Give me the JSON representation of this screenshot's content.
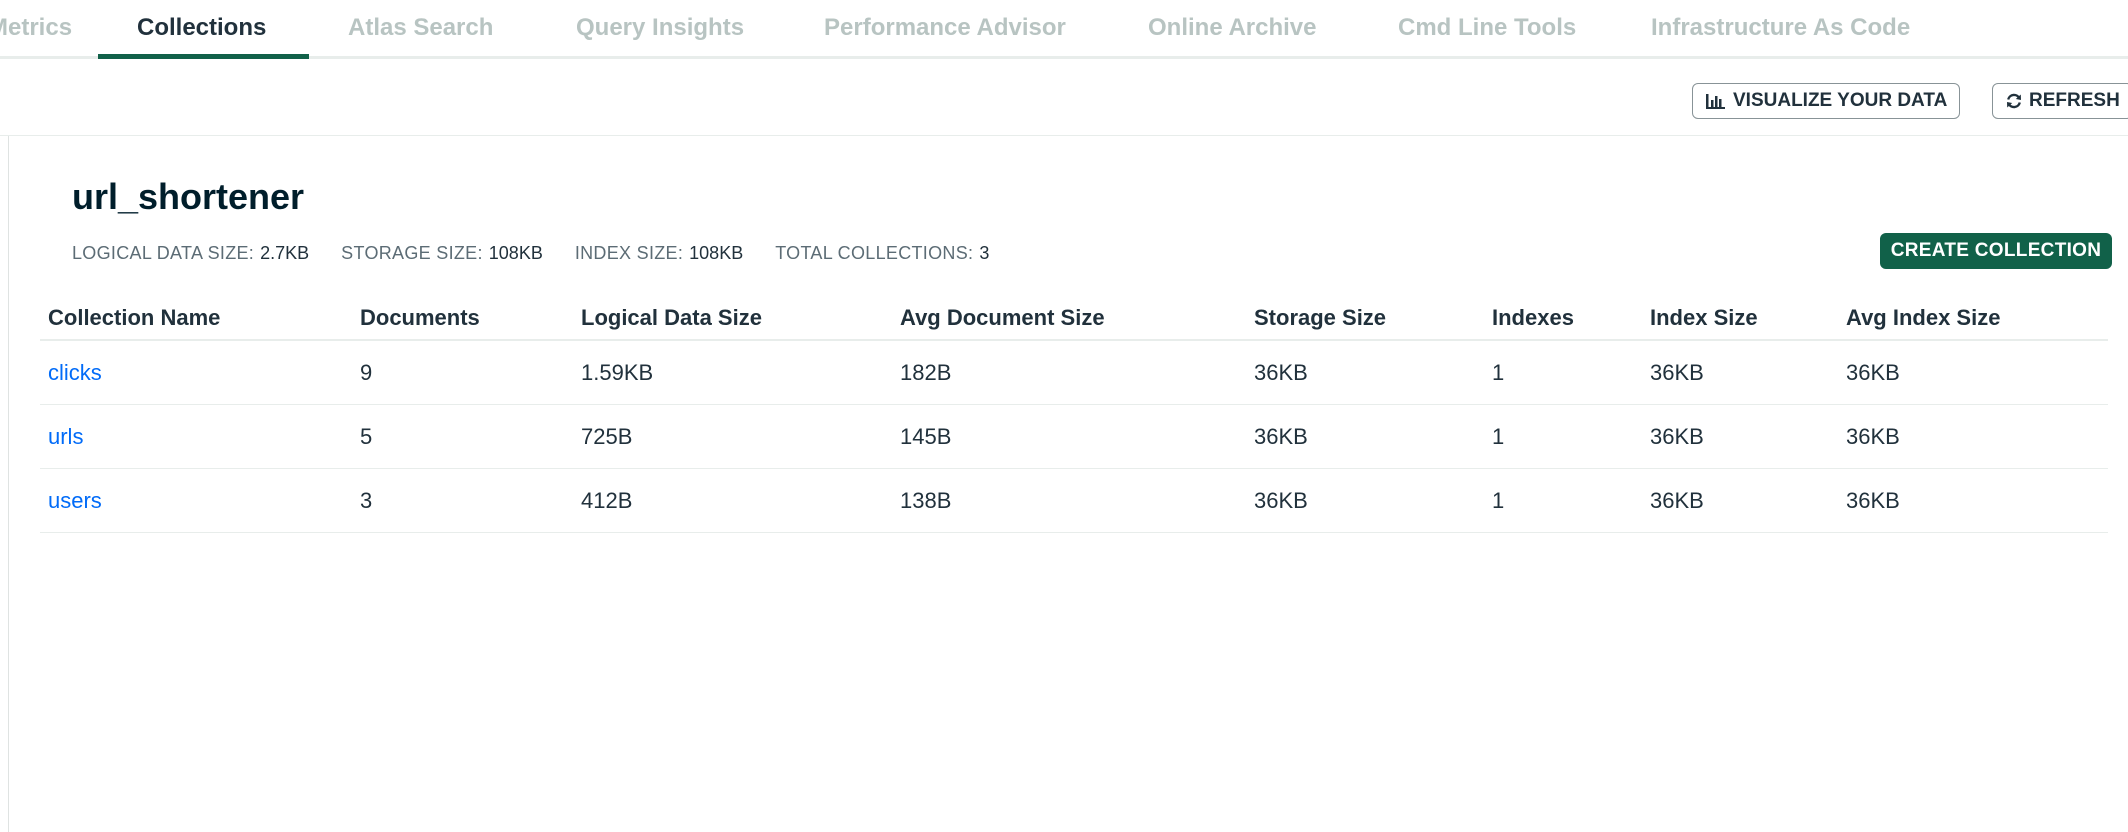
{
  "tabs": [
    {
      "label": "Metrics"
    },
    {
      "label": "Collections"
    },
    {
      "label": "Atlas Search"
    },
    {
      "label": "Query Insights"
    },
    {
      "label": "Performance Advisor"
    },
    {
      "label": "Online Archive"
    },
    {
      "label": "Cmd Line Tools"
    },
    {
      "label": "Infrastructure As Code"
    }
  ],
  "toolbar": {
    "visualize_label": "VISUALIZE YOUR DATA",
    "refresh_label": "REFRESH"
  },
  "database": {
    "name": "url_shortener",
    "stats": [
      {
        "label": "LOGICAL DATA SIZE:",
        "value": "2.7KB"
      },
      {
        "label": "STORAGE SIZE:",
        "value": "108KB"
      },
      {
        "label": "INDEX SIZE:",
        "value": "108KB"
      },
      {
        "label": "TOTAL COLLECTIONS:",
        "value": "3"
      }
    ],
    "create_label": "CREATE COLLECTION"
  },
  "table": {
    "headers": [
      "Collection Name",
      "Documents",
      "Logical Data Size",
      "Avg Document Size",
      "Storage Size",
      "Indexes",
      "Index Size",
      "Avg Index Size"
    ],
    "rows": [
      [
        "clicks",
        "9",
        "1.59KB",
        "182B",
        "36KB",
        "1",
        "36KB",
        "36KB"
      ],
      [
        "urls",
        "5",
        "725B",
        "145B",
        "36KB",
        "1",
        "36KB",
        "36KB"
      ],
      [
        "users",
        "3",
        "412B",
        "138B",
        "36KB",
        "1",
        "36KB",
        "36KB"
      ]
    ]
  },
  "colors": {
    "accent_green": "#116149",
    "link_blue": "#016bf8",
    "muted_tab": "#b8c4c2"
  }
}
